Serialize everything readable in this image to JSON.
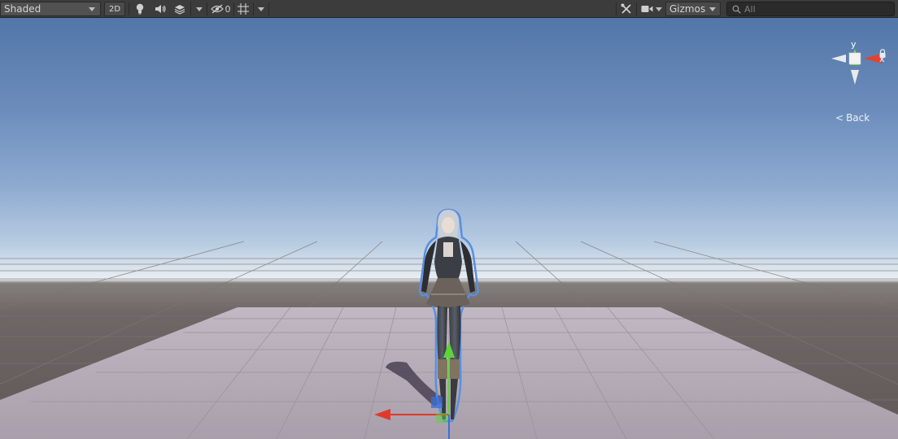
{
  "toolbar": {
    "draw_mode": "Shaded",
    "mode_2d": "2D",
    "hidden_count": "0",
    "gizmos": "Gizmos",
    "search_placeholder": "All"
  },
  "orientation": {
    "y_label": "y",
    "x_label": "x",
    "back_label": "Back"
  },
  "icons": [
    "lightbulb-icon",
    "speaker-icon",
    "layers-icon",
    "hidden-eye-icon",
    "grid-icon",
    "tools-icon",
    "camera-icon",
    "search-icon",
    "lock-icon"
  ],
  "colors": {
    "toolbar_bg": "#3c3c3c",
    "sky_top": "#5276a8",
    "horizon": "#e9eef2",
    "ground": "#5f5857",
    "plane": "#b5abb7",
    "axis_x": "#e0392b",
    "axis_y": "#5fd23a",
    "axis_z": "#3b6fd9",
    "selection_outline": "#5a8fe0"
  }
}
